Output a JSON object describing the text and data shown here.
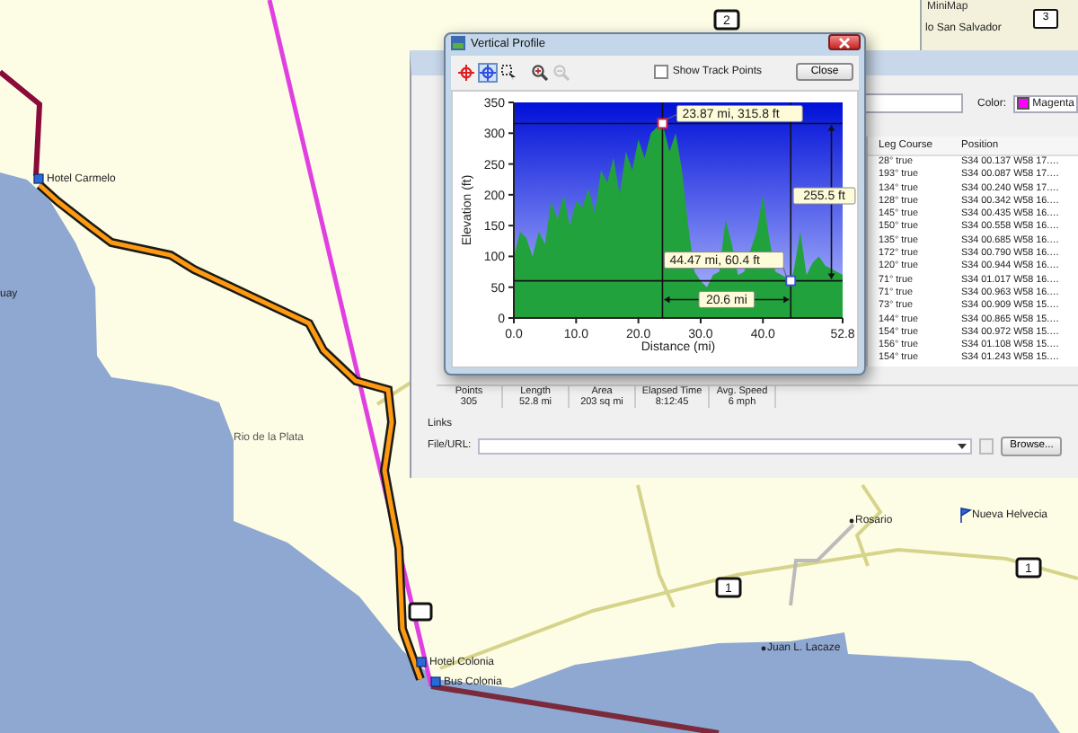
{
  "map": {
    "places": [
      {
        "name": "Hotel Carmelo",
        "kind": "poi"
      },
      {
        "name": "uay",
        "kind": "town"
      },
      {
        "name": "Rio de la Plata",
        "kind": "water"
      },
      {
        "name": "Hotel Colonia",
        "kind": "poi"
      },
      {
        "name": "Bus Colonia",
        "kind": "poi"
      },
      {
        "name": "Rosario",
        "kind": "town"
      },
      {
        "name": "Nueva Helvecia",
        "kind": "flag"
      },
      {
        "name": "Juan L. Lacaze",
        "kind": "town"
      }
    ],
    "road_shields": [
      "2",
      "1",
      "1"
    ]
  },
  "minimap": {
    "title": "MiniMap",
    "place": "lo San Salvador",
    "shield": "3"
  },
  "properties": {
    "color_label": "Color:",
    "color": {
      "name": "Magenta",
      "color": "#ff00ff"
    },
    "table": {
      "columns": [
        "Leg Course",
        "Position"
      ],
      "rows": [
        {
          "leg_course": "28° true",
          "position": "S34 00.137 W58 17.…"
        },
        {
          "leg_course": "193° true",
          "position": "S34 00.087 W58 17.…"
        },
        {
          "leg_course": "134° true",
          "position": "S34 00.240 W58 17.…"
        },
        {
          "leg_course": "128° true",
          "position": "S34 00.342 W58 16.…"
        },
        {
          "leg_course": "145° true",
          "position": "S34 00.435 W58 16.…"
        },
        {
          "leg_course": "150° true",
          "position": "S34 00.558 W58 16.…"
        },
        {
          "leg_course": "135° true",
          "position": "S34 00.685 W58 16.…"
        },
        {
          "leg_course": "172° true",
          "position": "S34 00.790 W58 16.…"
        },
        {
          "leg_course": "120° true",
          "position": "S34 00.944 W58 16.…"
        },
        {
          "leg_course": "71° true",
          "position": "S34 01.017 W58 16.…"
        },
        {
          "leg_course": "71° true",
          "position": "S34 00.963 W58 16.…"
        },
        {
          "leg_course": "73° true",
          "position": "S34 00.909 W58 15.…"
        },
        {
          "leg_course": "144° true",
          "position": "S34 00.865 W58 15.…"
        },
        {
          "leg_course": "154° true",
          "position": "S34 00.972 W58 15.…"
        },
        {
          "leg_course": "156° true",
          "position": "S34 01.108 W58 15.…"
        },
        {
          "leg_course": "154° true",
          "position": "S34 01.243 W58 15.…"
        }
      ]
    },
    "stats": [
      {
        "label": "Points",
        "value": "305"
      },
      {
        "label": "Length",
        "value": "52.8 mi"
      },
      {
        "label": "Area",
        "value": "203 sq mi"
      },
      {
        "label": "Elapsed Time",
        "value": "8:12:45"
      },
      {
        "label": "Avg. Speed",
        "value": "6 mph"
      }
    ],
    "links_label": "Links",
    "file_label": "File/URL:",
    "browse": "Browse..."
  },
  "profile": {
    "title": "Vertical Profile",
    "tools": [
      {
        "kind": "add-point",
        "selected": false,
        "disabled": false
      },
      {
        "kind": "select-point",
        "selected": true,
        "disabled": false
      },
      {
        "kind": "select-area",
        "selected": false,
        "disabled": false
      },
      {
        "kind": "zoom-in",
        "selected": false,
        "disabled": false
      },
      {
        "kind": "zoom-out",
        "selected": false,
        "disabled": true
      }
    ],
    "show_track_points": {
      "label": "Show Track Points",
      "checked": false
    },
    "close": "Close",
    "chart_data": {
      "type": "area",
      "xlabel": "Distance  (mi)",
      "ylabel": "Elevation (ft)",
      "x": [
        0,
        1,
        2,
        3,
        4,
        5,
        6,
        7,
        8,
        9,
        10,
        11,
        12,
        13,
        14,
        15,
        16,
        17,
        18,
        19,
        20,
        21,
        22,
        23,
        23.87,
        25,
        26,
        27,
        28,
        29,
        30,
        31,
        32,
        33,
        34,
        35,
        36,
        37,
        38,
        39,
        40,
        41,
        42,
        43,
        44.47,
        45,
        46,
        47,
        48,
        49,
        50,
        51,
        52.8
      ],
      "series": [
        {
          "color": "#22a23c",
          "values": [
            100,
            140,
            130,
            100,
            140,
            120,
            190,
            160,
            200,
            150,
            190,
            180,
            210,
            170,
            240,
            220,
            260,
            200,
            270,
            240,
            290,
            260,
            300,
            310,
            316,
            270,
            300,
            240,
            150,
            75,
            60,
            50,
            70,
            75,
            160,
            120,
            70,
            75,
            110,
            140,
            200,
            130,
            75,
            70,
            60,
            80,
            140,
            70,
            90,
            100,
            85,
            80,
            70
          ]
        }
      ],
      "xlim": [
        0,
        52.8
      ],
      "ylim": [
        0,
        350
      ],
      "xticks": [
        {
          "value": 0,
          "label": "0.0"
        },
        {
          "value": 10,
          "label": "10.0"
        },
        {
          "value": 20,
          "label": "20.0"
        },
        {
          "value": 30,
          "label": "30.0"
        },
        {
          "value": 40,
          "label": "40.0"
        },
        {
          "value": 52.8,
          "label": "52.8"
        }
      ],
      "yticks": [
        0,
        50,
        100,
        150,
        200,
        250,
        300,
        350
      ],
      "annotations": [
        {
          "text": "23.87 mi, 315.8 ft",
          "x": 23.87,
          "y": 315.8
        },
        {
          "text": "44.47 mi, 60.4 ft",
          "x": 44.47,
          "y": 60.4
        },
        {
          "text": "255.5 ft"
        },
        {
          "text": "20.6 mi"
        }
      ]
    }
  }
}
